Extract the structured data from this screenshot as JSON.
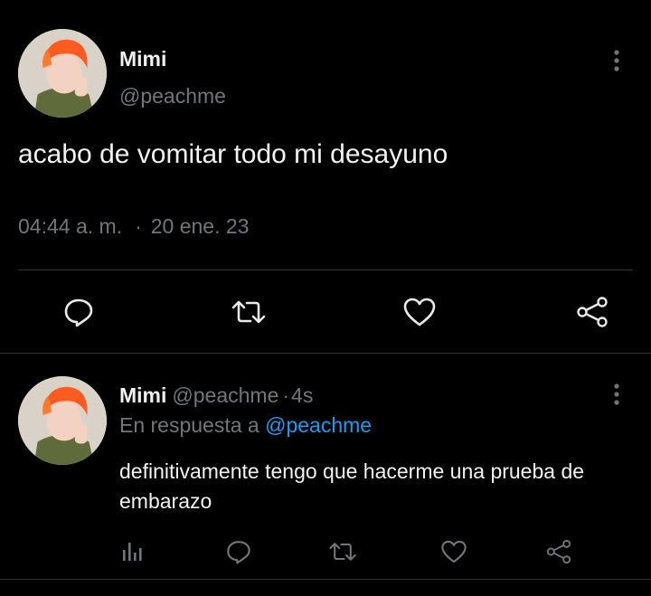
{
  "colors": {
    "background": "#000000",
    "text": "#f2f2f2",
    "muted": "#71767b",
    "link": "#1d9bf0",
    "divider": "#2f3336"
  },
  "tweet": {
    "avatar": "avatar-photo",
    "name": "Mimi",
    "handle": "@peachme",
    "text": "acabo de vomitar todo mi desayuno",
    "time": "04:44 a. m.",
    "separator": "·",
    "date": "20 ene. 23",
    "actions": [
      "reply-icon",
      "retweet-icon",
      "like-icon",
      "share-icon"
    ]
  },
  "reply": {
    "avatar": "avatar-photo",
    "name": "Mimi",
    "handle": "@peachme",
    "time_sep": "·",
    "time": "4s",
    "replying_prefix": "En respuesta a",
    "replying_to": "@peachme",
    "text": "definitivamente tengo que hacerme una prueba de embarazo",
    "actions": [
      "analytics-icon",
      "reply-icon",
      "retweet-icon",
      "like-icon",
      "share-icon"
    ]
  }
}
